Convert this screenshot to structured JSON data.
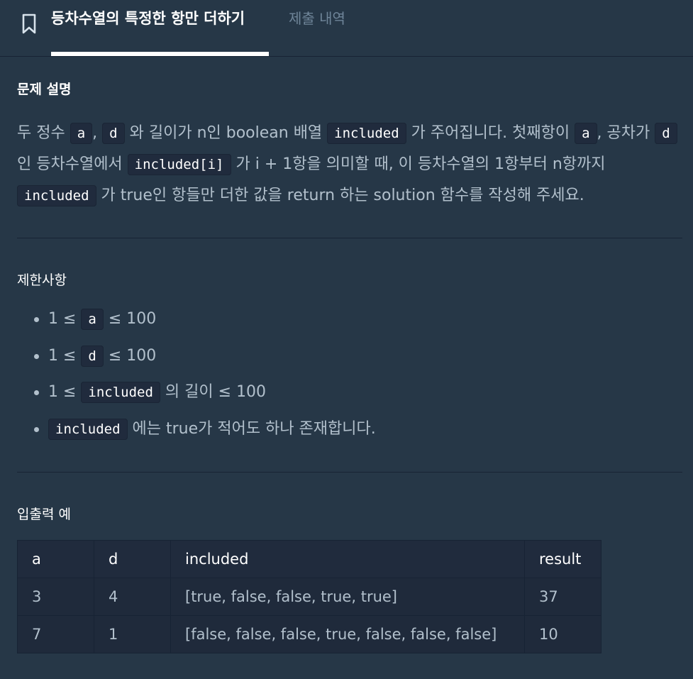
{
  "header": {
    "tabs": [
      {
        "label": "등차수열의 특정한 항만 더하기",
        "active": true
      },
      {
        "label": "제출 내역",
        "active": false
      }
    ]
  },
  "description": {
    "title": "문제 설명",
    "p1": "두 정수 ",
    "code_a": "a",
    "p2": ", ",
    "code_d": "d",
    "p3": " 와 길이가 n인 boolean 배열 ",
    "code_included": "included",
    "p4": " 가 주어집니다. 첫째항이 ",
    "code_a2": "a",
    "p5": ", 공차가 ",
    "code_d2": "d",
    "p6": " 인 등차수열에서 ",
    "code_included_i": "included[i]",
    "p7": " 가 i + 1항을 의미할 때, 이 등차수열의 1항부터 n항까지 ",
    "code_included2": "included",
    "p8": " 가 true인 항들만 더한 값을 return 하는 solution 함수를 작성해 주세요."
  },
  "limits": {
    "title": "제한사항",
    "items": [
      {
        "pre": "1 ≤ ",
        "code": "a",
        "post": " ≤ 100"
      },
      {
        "pre": "1 ≤ ",
        "code": "d",
        "post": " ≤ 100"
      },
      {
        "pre": "1 ≤ ",
        "code": "included",
        "post": " 의 길이 ≤ 100"
      },
      {
        "pre": "",
        "code": "included",
        "post": " 에는 true가 적어도 하나 존재합니다."
      }
    ]
  },
  "io": {
    "title": "입출력 예",
    "headers": [
      "a",
      "d",
      "included",
      "result"
    ],
    "rows": [
      [
        "3",
        "4",
        "[true, false, false, true, true]",
        "37"
      ],
      [
        "7",
        "1",
        "[false, false, false, true, false, false, false]",
        "10"
      ]
    ]
  }
}
